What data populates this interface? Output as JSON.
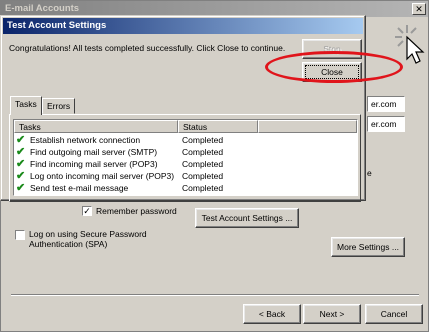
{
  "outer": {
    "title": "E-mail Accounts",
    "close_glyph": "✕",
    "visible_field_1": "er.com",
    "visible_field_2": "er.com",
    "side_char": "e",
    "remember_password_label": "Remember password",
    "remember_password_checked": true,
    "test_account_settings_label": "Test Account Settings ...",
    "spa_label": "Log on using Secure Password Authentication (SPA)",
    "spa_checked": false,
    "more_settings_label": "More Settings ...",
    "back_label": "< Back",
    "next_label": "Next >",
    "cancel_label": "Cancel"
  },
  "dialog": {
    "title": "Test Account Settings",
    "message": "Congratulations! All tests completed successfully. Click Close to continue.",
    "stop_label": "Stop",
    "close_label": "Close",
    "tabs": [
      {
        "label": "Tasks",
        "active": true
      },
      {
        "label": "Errors",
        "active": false
      }
    ],
    "columns": [
      "Tasks",
      "Status"
    ],
    "tasks": [
      {
        "task": "Establish network connection",
        "status": "Completed"
      },
      {
        "task": "Find outgoing mail server (SMTP)",
        "status": "Completed"
      },
      {
        "task": "Find incoming mail server (POP3)",
        "status": "Completed"
      },
      {
        "task": "Log onto incoming mail server (POP3)",
        "status": "Completed"
      },
      {
        "task": "Send test e-mail message",
        "status": "Completed"
      }
    ]
  },
  "icons": {
    "check": "✔",
    "checkbox_mark": "✓"
  },
  "colors": {
    "highlight_ellipse": "#e0141b",
    "active_title": "#0a246a",
    "check_green": "#1a8a1a"
  }
}
